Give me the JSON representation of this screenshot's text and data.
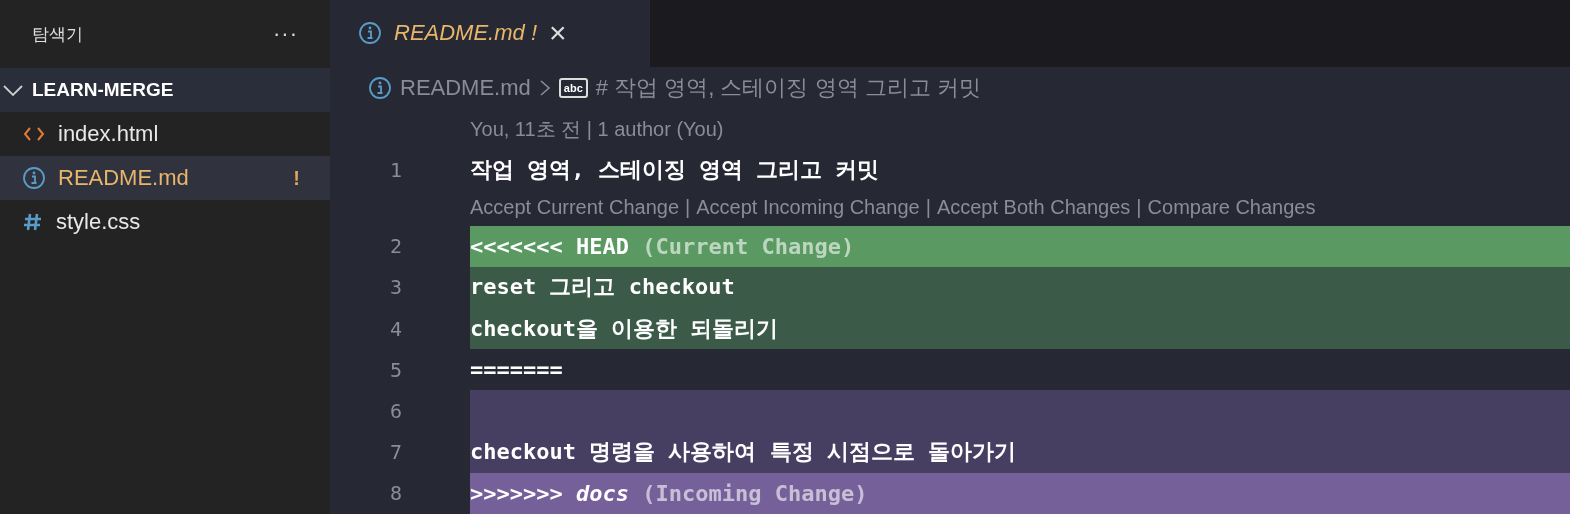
{
  "sidebar": {
    "title": "탐색기",
    "more": "···",
    "folder": {
      "name": "LEARN-MERGE",
      "expanded": true,
      "files": [
        {
          "name": "index.html",
          "kind": "html",
          "selected": false
        },
        {
          "name": "README.md",
          "kind": "info",
          "selected": true,
          "badge": "!"
        },
        {
          "name": "style.css",
          "kind": "css",
          "selected": false
        }
      ]
    }
  },
  "tabs": [
    {
      "label": "README.md",
      "modified_mark": "!",
      "selected": true,
      "close": "×"
    }
  ],
  "breadcrumb": {
    "file": "README.md",
    "symbol_badge": "abc",
    "symbol": "# 작업 영역, 스테이징 영역 그리고 커밋"
  },
  "editor": {
    "blame": "You, 11초 전 | 1 author (You)",
    "actions": [
      "Accept Current Change",
      "Accept Incoming Change",
      "Accept Both Changes",
      "Compare Changes"
    ],
    "action_separator": "|",
    "lines": [
      {
        "number": "1",
        "kind": "normal",
        "text": "작업 영역, 스테이징 영역 그리고 커밋"
      },
      {
        "number": "2",
        "kind": "current-header",
        "marker": "<<<<<<<",
        "branch": "HEAD",
        "note": "(Current Change)"
      },
      {
        "number": "3",
        "kind": "current",
        "text": "reset 그리고 checkout"
      },
      {
        "number": "4",
        "kind": "current",
        "text": "checkout을 이용한 되돌리기"
      },
      {
        "number": "5",
        "kind": "normal",
        "text": "======="
      },
      {
        "number": "6",
        "kind": "incoming"
      },
      {
        "number": "7",
        "kind": "incoming",
        "text": "checkout 명령을 사용하여 특정 시점으로 돌아가기"
      },
      {
        "number": "8",
        "kind": "incoming-header",
        "marker": ">>>>>>>",
        "branch": "docs",
        "note": "(Incoming Change)"
      }
    ]
  }
}
